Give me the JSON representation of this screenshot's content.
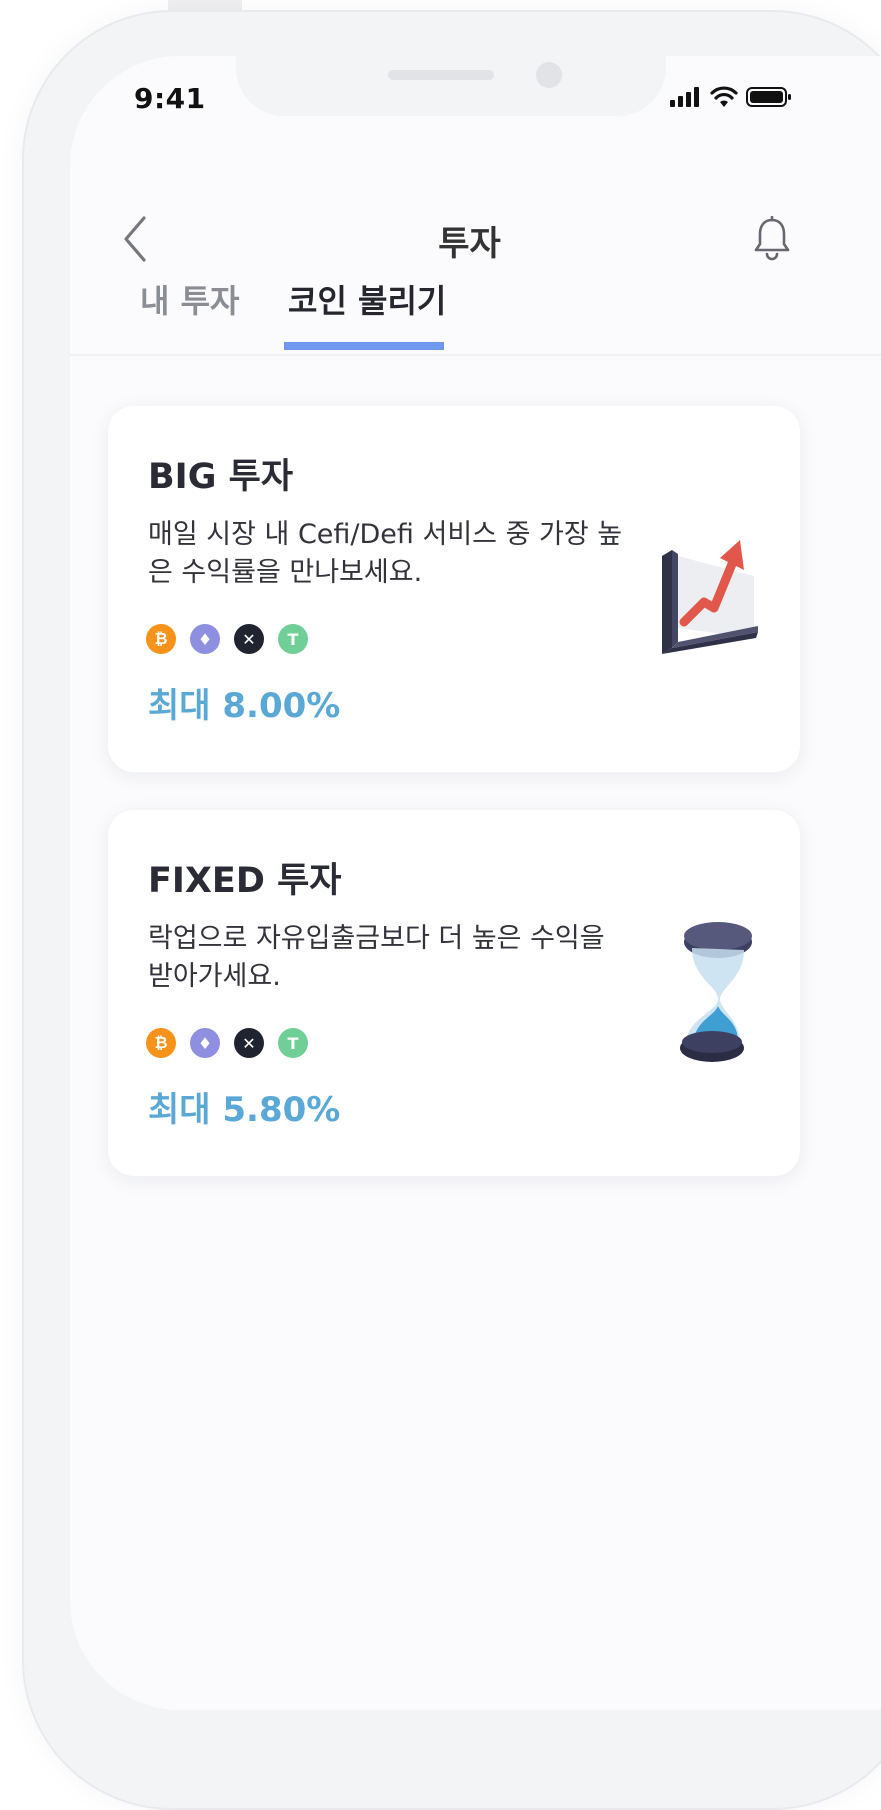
{
  "status_bar": {
    "time": "9:41"
  },
  "header": {
    "title": "투자"
  },
  "tabs": [
    {
      "label": "내 투자",
      "active": false
    },
    {
      "label": "코인 불리기",
      "active": true
    }
  ],
  "cards": [
    {
      "title": "BIG 투자",
      "description": "매일 시장 내 Cefi/Defi 서비스 중 가장 높은 수익률을 만나보세요.",
      "coins": [
        "bitcoin-icon",
        "ethereum-icon",
        "xrp-icon",
        "tether-icon"
      ],
      "rate": "최대 8.00%",
      "illustration": "growth-chart-icon"
    },
    {
      "title": "FIXED 투자",
      "description": "락업으로 자유입출금보다 더 높은 수익을 받아가세요.",
      "coins": [
        "bitcoin-icon",
        "ethereum-icon",
        "xrp-icon",
        "tether-icon"
      ],
      "rate": "최대 5.80%",
      "illustration": "hourglass-icon"
    }
  ],
  "colors": {
    "accent_tab": "#6f98ee",
    "rate_text": "#5aa8d6",
    "bitcoin": "#f7931a",
    "ethereum": "#8e8fe0",
    "xrp": "#1f2430",
    "tether": "#6fcf97"
  }
}
